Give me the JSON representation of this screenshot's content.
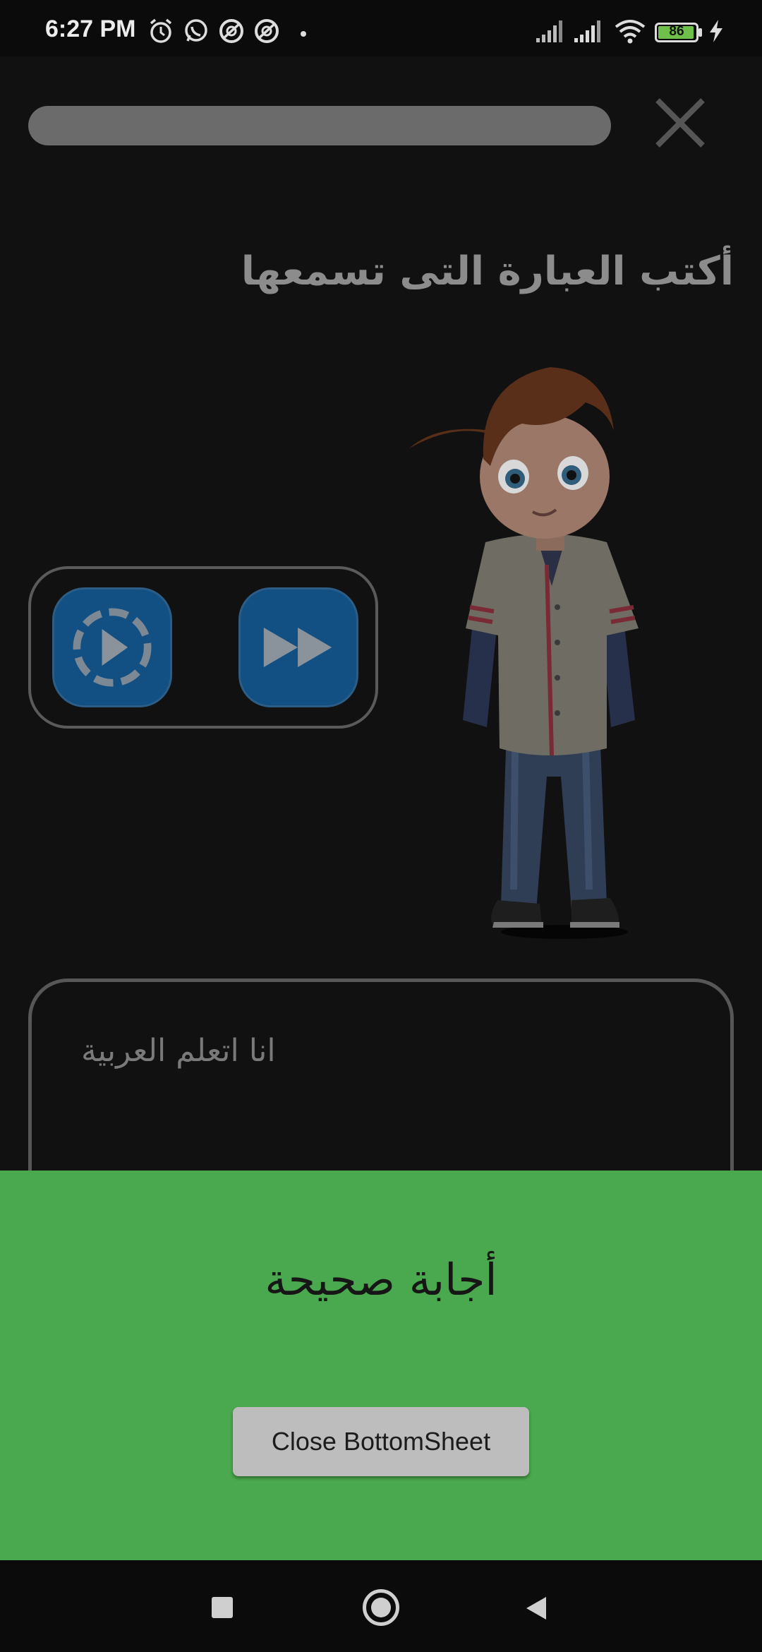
{
  "status_bar": {
    "time": "6:27 PM",
    "battery": "86",
    "icons": [
      "alarm-icon",
      "whatsapp-icon",
      "app-notification-icon",
      "app-notification-icon",
      "dot-icon",
      "signal-icon",
      "signal-icon",
      "wifi-icon",
      "battery-icon",
      "charging-icon"
    ]
  },
  "lesson": {
    "progress": 0.0,
    "prompt": "أكتب العبارة التى تسمعها",
    "controls": {
      "play_slow_icon": "slow-play-icon",
      "fast_forward_icon": "fast-forward-icon"
    },
    "character_image": "cartoon-boy-illustration",
    "answer_value": "انا اتعلم العربية"
  },
  "bottom_sheet": {
    "result_text": "أجابة صحيحة",
    "close_label": "Close BottomSheet",
    "background_color": "#4aa84e"
  },
  "nav_bar": {
    "icons": [
      "recents-square-icon",
      "home-circle-icon",
      "back-triangle-icon"
    ]
  },
  "colors": {
    "accent_button": "#124f83",
    "background": "#111111"
  }
}
